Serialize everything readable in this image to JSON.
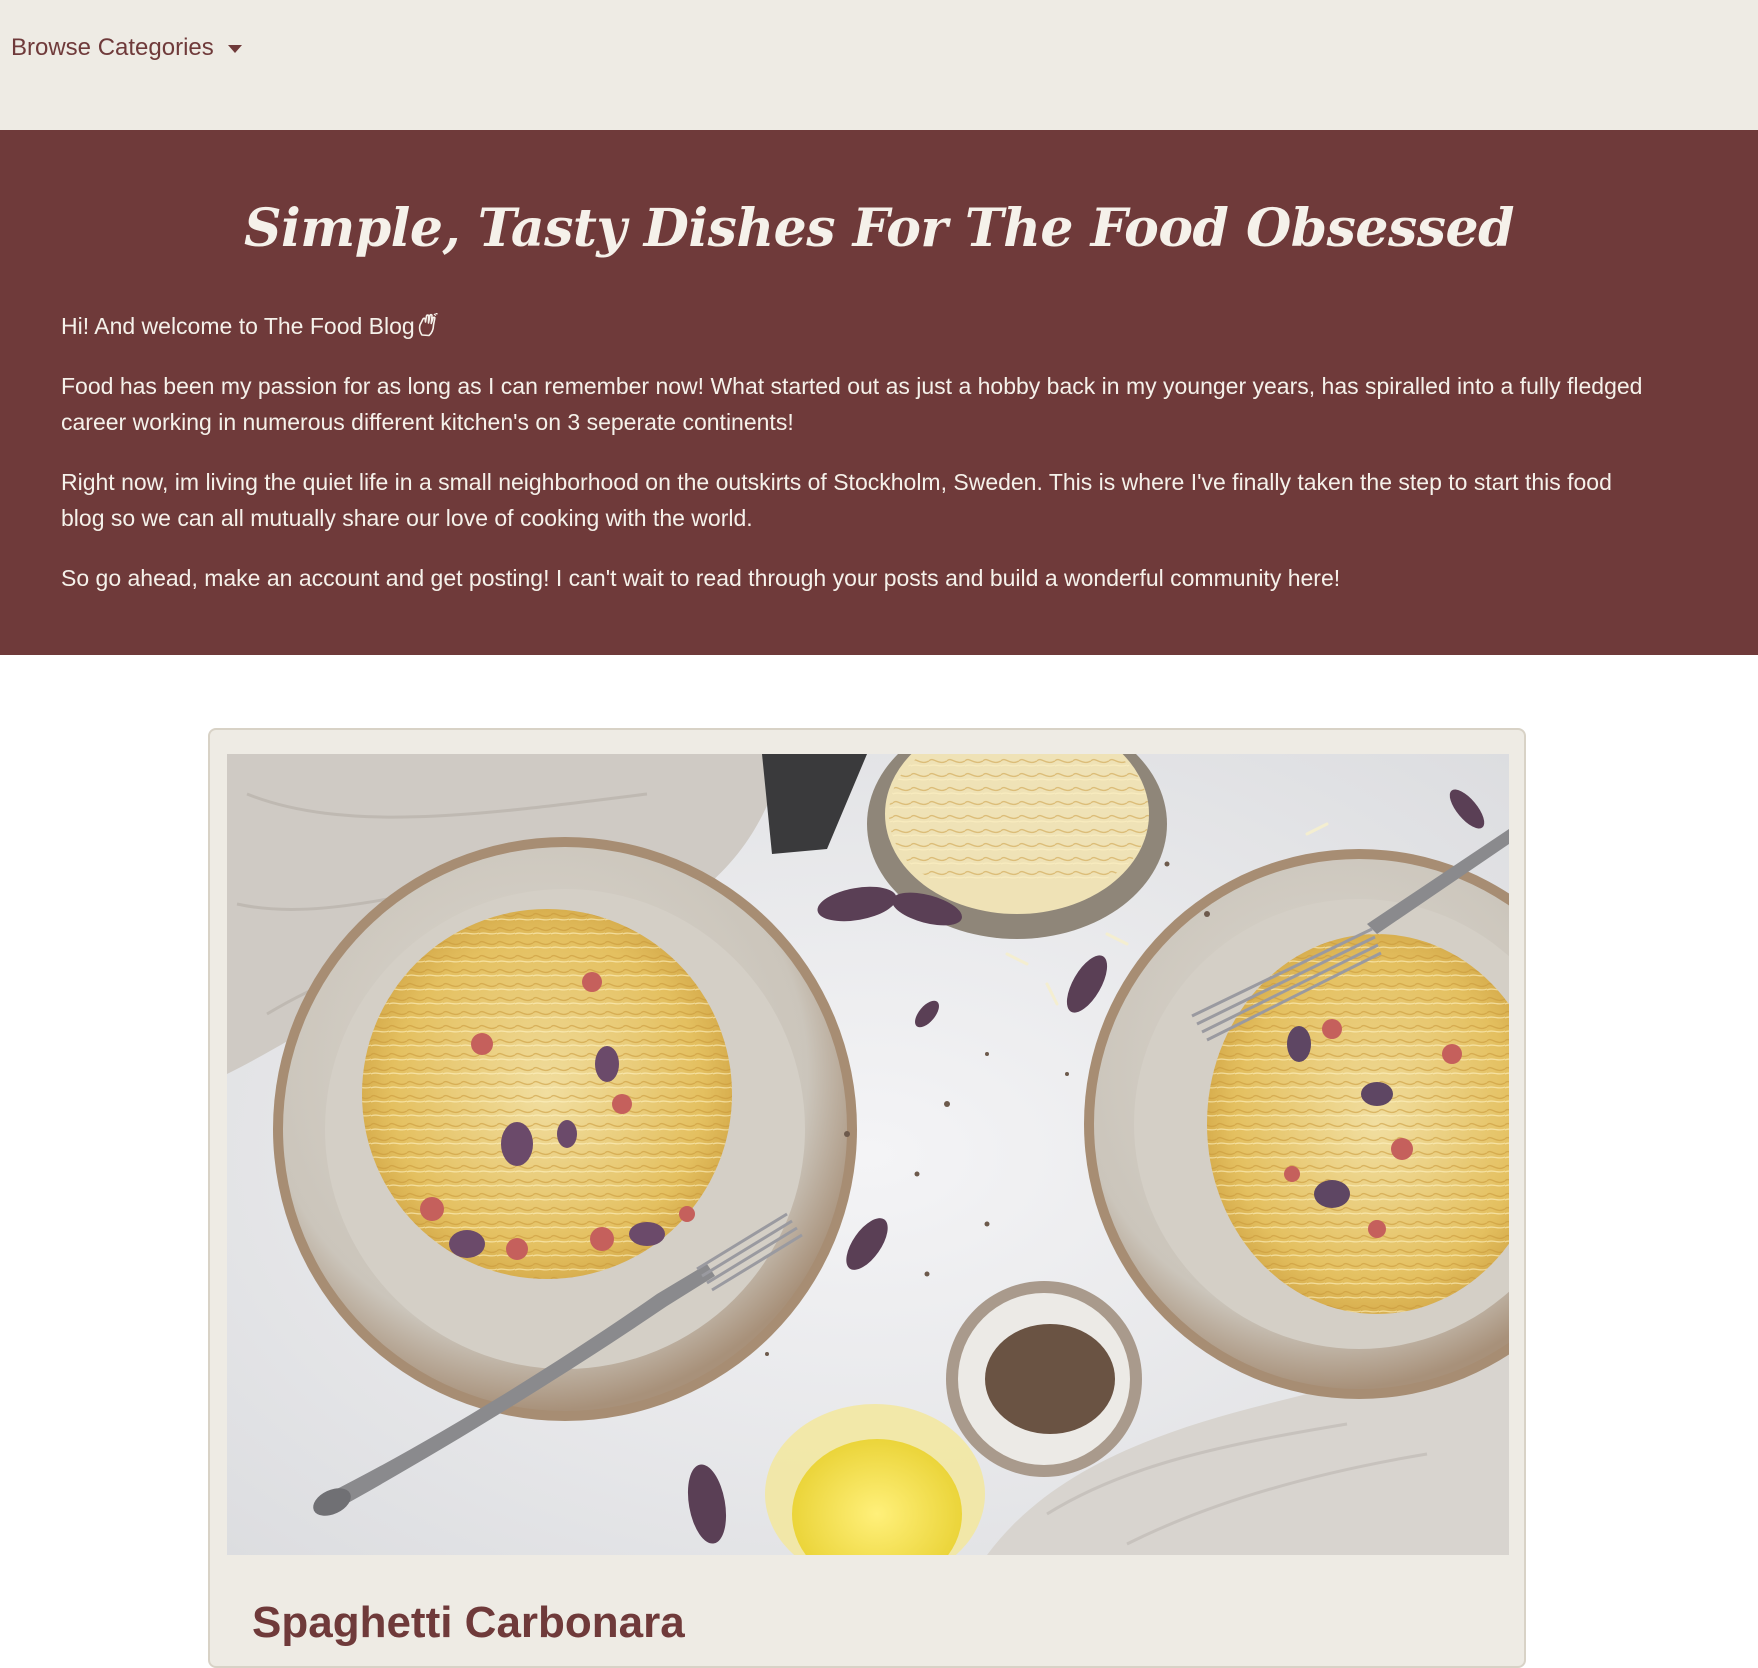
{
  "nav": {
    "dropdown_label": "Browse Categories"
  },
  "hero": {
    "title": "Simple, Tasty Dishes For The Food Obsessed",
    "greeting": "Hi! And welcome to The Food Blog",
    "greeting_icon": "waving-hand-icon",
    "paragraphs": [
      "Food has been my passion for as long as I can remember now! What started out as just a hobby back in my younger years, has spiralled into a fully fledged career working in numerous different kitchen's on 3 seperate continents!",
      "Right now, im living the quiet life in a small neighborhood on the outskirts of Stockholm, Sweden. This is where I've finally taken the step to start this food blog so we can all mutually share our love of cooking with the world.",
      "So go ahead, make an account and get posting! I can't wait to read through your posts and build a wonderful community here!"
    ]
  },
  "post": {
    "title": "Spaghetti Carbonara",
    "image_icon": "spaghetti-carbonara-photo"
  },
  "colors": {
    "brand": "#6f3a3a",
    "nav_bg": "#eeebe4",
    "hero_text": "#f5f1ea"
  }
}
